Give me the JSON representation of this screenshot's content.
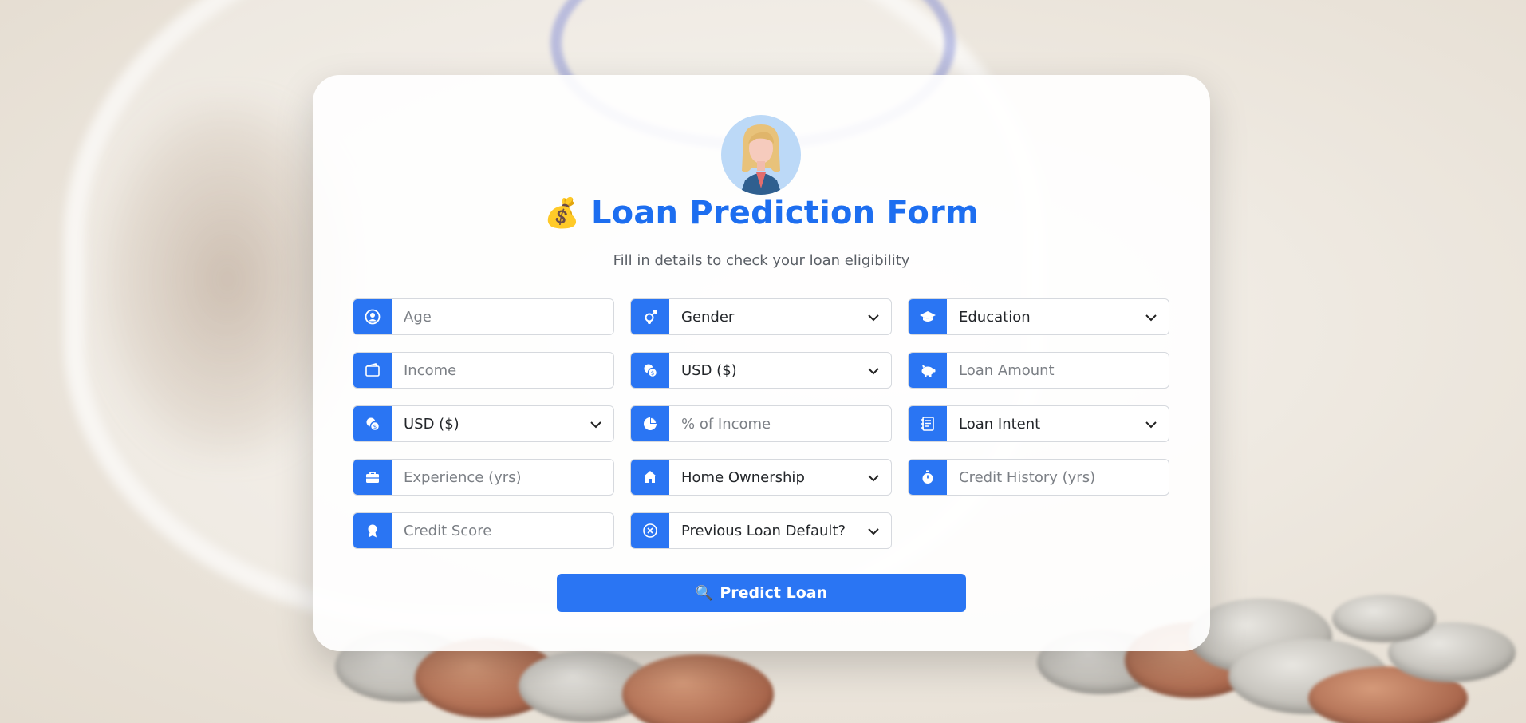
{
  "header": {
    "title": "Loan Prediction Form",
    "title_emoji": "💰",
    "subtitle": "Fill in details to check your loan eligibility"
  },
  "fields": {
    "age": {
      "icon": "user-circle-icon",
      "placeholder": "Age"
    },
    "gender": {
      "icon": "gender-icon",
      "selected": "Gender"
    },
    "education": {
      "icon": "graduation-cap-icon",
      "selected": "Education"
    },
    "income": {
      "icon": "wallet-icon",
      "placeholder": "Income"
    },
    "income_currency": {
      "icon": "coins-icon",
      "selected": "USD ($)"
    },
    "loan_amount": {
      "icon": "piggy-bank-icon",
      "placeholder": "Loan Amount"
    },
    "loan_currency": {
      "icon": "coins-icon",
      "selected": "USD ($)"
    },
    "percent_income": {
      "icon": "pie-chart-icon",
      "placeholder": "% of Income"
    },
    "loan_intent": {
      "icon": "notebook-icon",
      "selected": "Loan Intent"
    },
    "experience": {
      "icon": "briefcase-icon",
      "placeholder": "Experience (yrs)"
    },
    "home_ownership": {
      "icon": "home-icon",
      "selected": "Home Ownership"
    },
    "credit_history": {
      "icon": "stopwatch-icon",
      "placeholder": "Credit History (yrs)"
    },
    "credit_score": {
      "icon": "award-icon",
      "placeholder": "Credit Score"
    },
    "previous_default": {
      "icon": "x-circle-icon",
      "selected": "Previous Loan Default?"
    }
  },
  "predict_button": {
    "label": "Predict Loan",
    "icon": "🔍"
  },
  "colors": {
    "accent": "#2a75f3",
    "title": "#1d6ef0",
    "avatar_bg": "#bcd9f7"
  }
}
